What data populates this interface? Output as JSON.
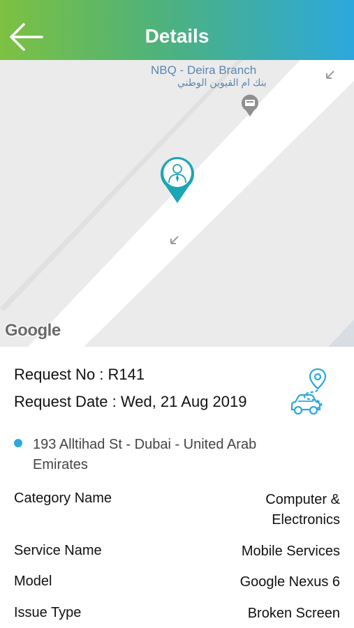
{
  "header": {
    "title": "Details",
    "back_icon": "arrow-left-icon"
  },
  "map": {
    "place_name": "NBQ - Deira Branch",
    "place_name_arabic": "بنك ام القيوين الوطني",
    "attribution": "Google",
    "marker_icon": "person-pin-icon",
    "poi_icon": "atm-icon"
  },
  "request": {
    "number_text": "Request No : R141",
    "date_text": "Request Date : Wed, 21 Aug 2019",
    "route_icon": "route-car-icon"
  },
  "address": "193 Alltihad St - Dubai - United Arab Emirates",
  "fields": {
    "category": {
      "label": "Category Name",
      "value": "Computer & Electronics"
    },
    "service": {
      "label": "Service Name",
      "value": "Mobile Services"
    },
    "model": {
      "label": "Model",
      "value": "Google Nexus 6"
    },
    "issue": {
      "label": "Issue Type",
      "value": "Broken Screen"
    }
  },
  "colors": {
    "header_start": "#7dc141",
    "header_end": "#2ca8dd",
    "accent": "#2ca8dd",
    "marker": "#1aa6b6"
  }
}
